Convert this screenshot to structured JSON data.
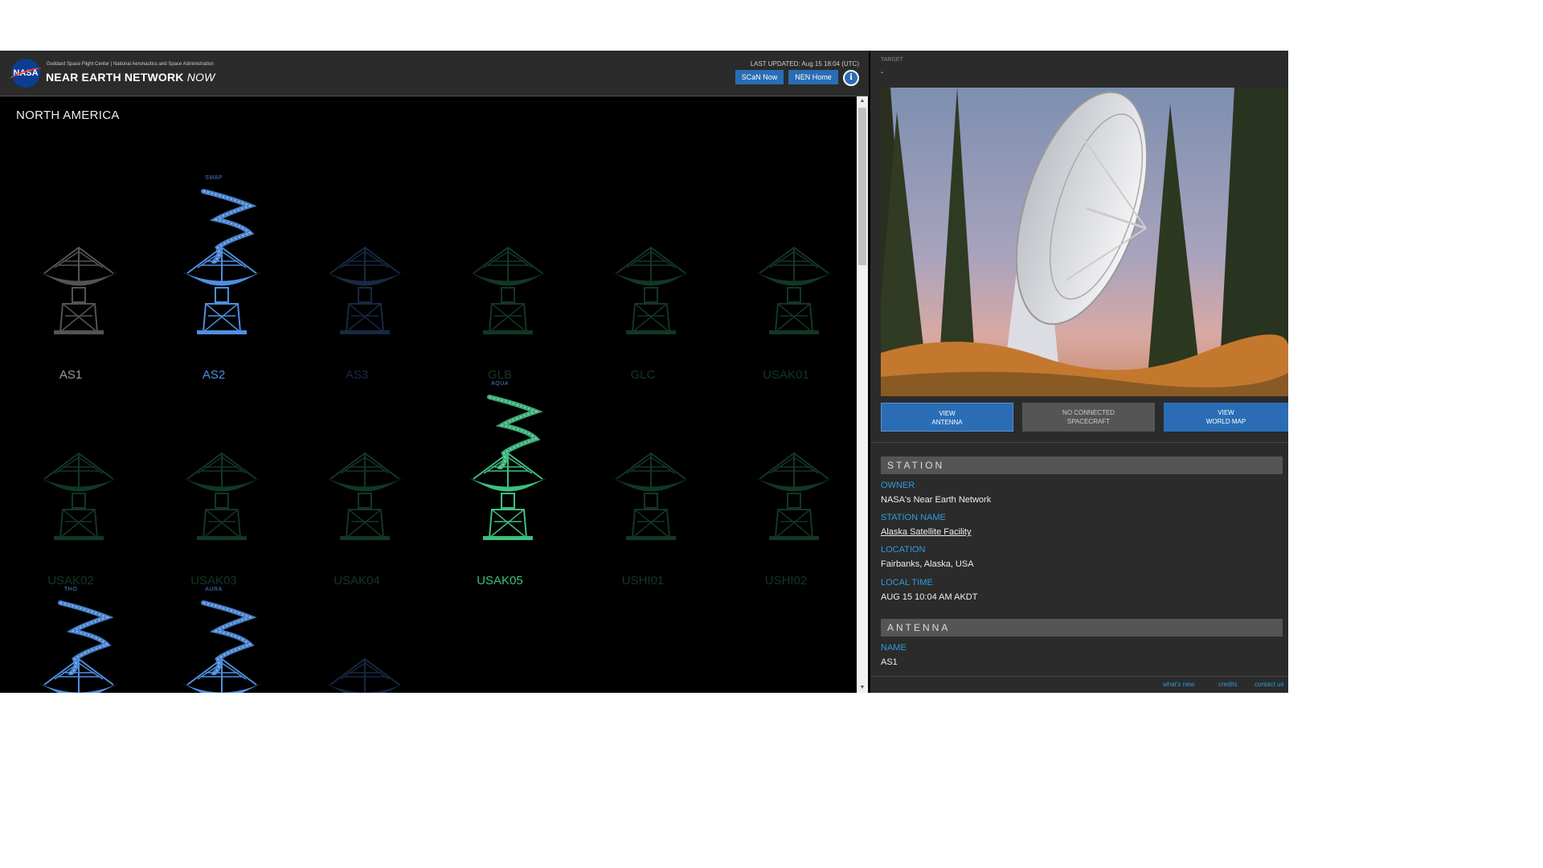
{
  "header": {
    "org_line": "Goddard Space Flight Center | National Aeronautics and Space Administration",
    "logo_text": "NASA",
    "title": "NEAR EARTH NETWORK",
    "title_suffix": "NOW",
    "last_updated": "LAST UPDATED: Aug 15 18:04 (UTC)",
    "scan_now": "SCaN Now",
    "nen_home": "NEN Home",
    "info": "i"
  },
  "region": "NORTH AMERICA",
  "antennas": [
    {
      "name": "AS1",
      "spacecraft": "",
      "state": "idle",
      "color": "#9a9a9a",
      "selected": true
    },
    {
      "name": "AS2",
      "spacecraft": "SMAP",
      "state": "active",
      "color": "#4f8fe0"
    },
    {
      "name": "AS3",
      "spacecraft": "",
      "state": "dim",
      "color": "#3a67a8"
    },
    {
      "name": "GLB",
      "spacecraft": "",
      "state": "dim",
      "color": "#2f8a5c"
    },
    {
      "name": "GLC",
      "spacecraft": "",
      "state": "dim",
      "color": "#2f8a5c"
    },
    {
      "name": "USAK01",
      "spacecraft": "",
      "state": "dim",
      "color": "#2f8a5c"
    },
    {
      "name": "USAK02",
      "spacecraft": "",
      "state": "dim",
      "color": "#2f8a5c"
    },
    {
      "name": "USAK03",
      "spacecraft": "",
      "state": "dim",
      "color": "#2f8a5c"
    },
    {
      "name": "USAK04",
      "spacecraft": "",
      "state": "dim",
      "color": "#2f8a5c"
    },
    {
      "name": "USAK05",
      "spacecraft": "AQUA",
      "state": "active",
      "color": "#3fbf7f"
    },
    {
      "name": "USHI01",
      "spacecraft": "",
      "state": "dim",
      "color": "#2f8a5c"
    },
    {
      "name": "USHI02",
      "spacecraft": "",
      "state": "dim",
      "color": "#2f8a5c"
    },
    {
      "name": "",
      "spacecraft": "THO",
      "state": "active",
      "color": "#4f8fe0"
    },
    {
      "name": "",
      "spacecraft": "AURA",
      "state": "active",
      "color": "#4f8fe0"
    },
    {
      "name": "",
      "spacecraft": "",
      "state": "dim",
      "color": "#3a67a8"
    }
  ],
  "right": {
    "target_caption": "TARGET",
    "target_value": "-",
    "btn_view_antenna_1": "VIEW",
    "btn_view_antenna_2": "ANTENNA",
    "btn_no_conn_1": "NO CONNECTED",
    "btn_no_conn_2": "SPACECRAFT",
    "btn_world_1": "VIEW",
    "btn_world_2": "WORLD MAP",
    "station_head": "STATION",
    "owner_cap": "OWNER",
    "owner_val": "NASA's Near Earth Network",
    "station_name_cap": "STATION NAME",
    "station_name_val": "Alaska Satellite Facility",
    "location_cap": "LOCATION",
    "location_val": "Fairbanks, Alaska, USA",
    "local_time_cap": "LOCAL TIME",
    "local_time_val": "AUG 15 10:04 AM AKDT",
    "antenna_head": "ANTENNA",
    "name_cap": "NAME",
    "name_val": "AS1",
    "footer_whats_new": "what's new",
    "footer_credits": "credits",
    "footer_contact": "contact us"
  },
  "colors": {
    "accent": "#2a6db5",
    "link": "#2f9be0",
    "panel": "#2b2b2b"
  }
}
